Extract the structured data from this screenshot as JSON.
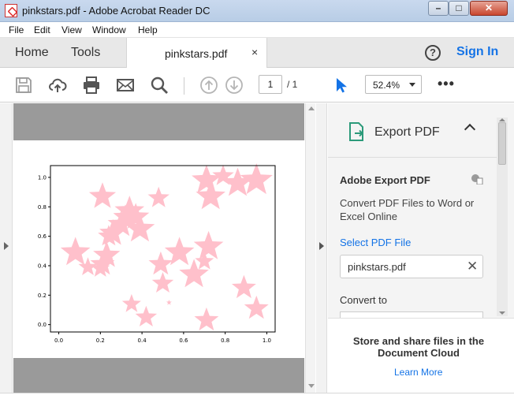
{
  "window": {
    "title": "pinkstars.pdf - Adobe Acrobat Reader DC",
    "controls": {
      "minimize": "–",
      "maximize": "□",
      "close": "✕"
    }
  },
  "menubar": {
    "items": [
      "File",
      "Edit",
      "View",
      "Window",
      "Help"
    ]
  },
  "tabbar": {
    "home": "Home",
    "tools": "Tools",
    "doc_tab": "pinkstars.pdf",
    "doc_close": "×",
    "help": "?",
    "sign_in": "Sign In"
  },
  "toolbar": {
    "icons": [
      "save-icon",
      "upload-cloud-icon",
      "print-icon",
      "email-icon",
      "search-icon",
      "page-up-icon",
      "page-down-icon",
      "select-cursor-icon",
      "more-icon"
    ],
    "page_current": "1",
    "page_total": "/ 1",
    "zoom": "52.4%",
    "more": "•••"
  },
  "chart_data": {
    "type": "scatter",
    "title": "",
    "xlabel": "",
    "ylabel": "",
    "xlim": [
      -0.04,
      1.04
    ],
    "ylim": [
      -0.05,
      1.08
    ],
    "xticks": [
      "0.0",
      "0.2",
      "0.4",
      "0.6",
      "0.8",
      "1.0"
    ],
    "yticks": [
      "0.0",
      "0.2",
      "0.4",
      "0.6",
      "0.8",
      "1.0"
    ],
    "marker": "star",
    "color": "#ffc0cb",
    "points": [
      {
        "x": 0.21,
        "y": 0.87,
        "s": 1.0
      },
      {
        "x": 0.34,
        "y": 0.77,
        "s": 1.1
      },
      {
        "x": 0.37,
        "y": 0.73,
        "s": 1.0
      },
      {
        "x": 0.32,
        "y": 0.73,
        "s": 0.9
      },
      {
        "x": 0.3,
        "y": 0.68,
        "s": 1.0
      },
      {
        "x": 0.39,
        "y": 0.65,
        "s": 1.1
      },
      {
        "x": 0.26,
        "y": 0.62,
        "s": 1.0
      },
      {
        "x": 0.24,
        "y": 0.6,
        "s": 0.8
      },
      {
        "x": 0.48,
        "y": 0.86,
        "s": 0.8
      },
      {
        "x": 0.08,
        "y": 0.49,
        "s": 1.1
      },
      {
        "x": 0.14,
        "y": 0.39,
        "s": 0.7
      },
      {
        "x": 0.23,
        "y": 0.47,
        "s": 1.0
      },
      {
        "x": 0.21,
        "y": 0.41,
        "s": 0.9
      },
      {
        "x": 0.2,
        "y": 0.38,
        "s": 0.7
      },
      {
        "x": 0.49,
        "y": 0.41,
        "s": 0.9
      },
      {
        "x": 0.5,
        "y": 0.28,
        "s": 0.8
      },
      {
        "x": 0.58,
        "y": 0.49,
        "s": 1.1
      },
      {
        "x": 0.65,
        "y": 0.34,
        "s": 1.1
      },
      {
        "x": 0.72,
        "y": 0.53,
        "s": 1.1
      },
      {
        "x": 0.7,
        "y": 0.43,
        "s": 0.7
      },
      {
        "x": 0.71,
        "y": 0.98,
        "s": 1.1
      },
      {
        "x": 0.73,
        "y": 0.87,
        "s": 1.1
      },
      {
        "x": 0.79,
        "y": 1.01,
        "s": 0.8
      },
      {
        "x": 0.86,
        "y": 0.96,
        "s": 1.1
      },
      {
        "x": 0.95,
        "y": 0.98,
        "s": 1.2
      },
      {
        "x": 0.89,
        "y": 0.25,
        "s": 0.9
      },
      {
        "x": 0.95,
        "y": 0.11,
        "s": 0.9
      },
      {
        "x": 0.35,
        "y": 0.14,
        "s": 0.7
      },
      {
        "x": 0.42,
        "y": 0.05,
        "s": 0.8
      },
      {
        "x": 0.53,
        "y": 0.15,
        "s": 0.2
      },
      {
        "x": 0.71,
        "y": 0.03,
        "s": 0.9
      }
    ]
  },
  "pane": {
    "export_title": "Export PDF",
    "heading": "Adobe Export PDF",
    "description": "Convert PDF Files to Word or Excel Online",
    "select_link": "Select PDF File",
    "file_name": "pinkstars.pdf",
    "clear": "✕",
    "convert_to": "Convert to",
    "share": "Store and share files in the Document Cloud",
    "learn_more": "Learn More",
    "accent": "#1473e6"
  }
}
